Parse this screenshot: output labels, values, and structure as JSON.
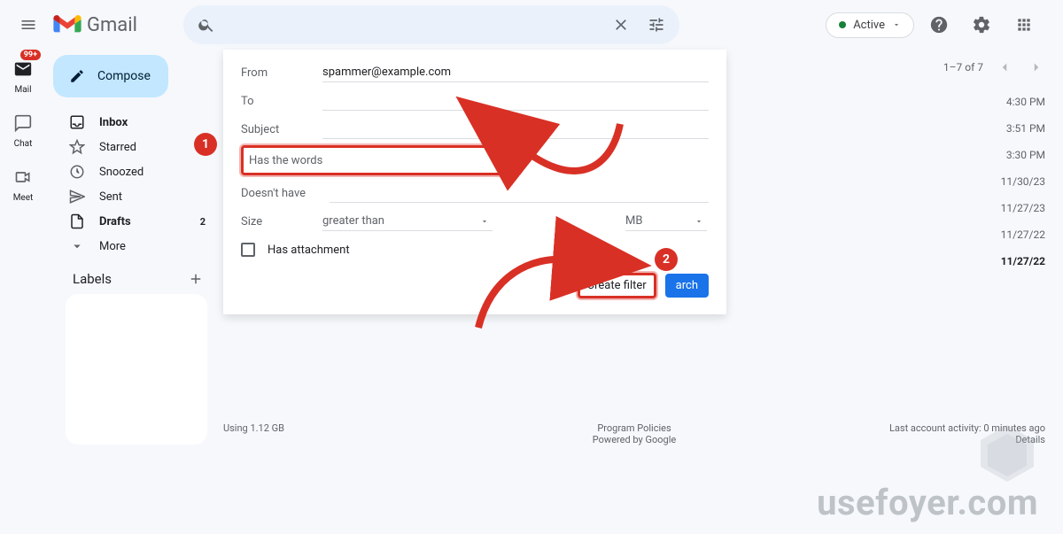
{
  "header": {
    "app_name": "Gmail",
    "active_label": "Active"
  },
  "rail": {
    "mail": "Mail",
    "chat": "Chat",
    "meet": "Meet",
    "badge": "99+"
  },
  "compose_label": "Compose",
  "folders": [
    {
      "label": "Inbox",
      "bold": true,
      "icon": "inbox"
    },
    {
      "label": "Starred",
      "icon": "star"
    },
    {
      "label": "Snoozed",
      "icon": "clock"
    },
    {
      "label": "Sent",
      "icon": "send"
    },
    {
      "label": "Drafts",
      "bold": true,
      "count": "2",
      "icon": "draft"
    },
    {
      "label": "More",
      "icon": "chevron"
    }
  ],
  "labels_header": "Labels",
  "filter": {
    "from_label": "From",
    "from_value": "spammer@example.com",
    "to_label": "To",
    "subject_label": "Subject",
    "haswords_label": "Has the words",
    "doesnthave_label": "Doesn't have",
    "size_label": "Size",
    "size_op": "greater than",
    "size_unit": "MB",
    "has_attachment_label": "Has attachment",
    "create_filter": "Create filter",
    "search_btn": "arch"
  },
  "page_info": "1–7 of 7",
  "mail_times": [
    "4:30 PM",
    "3:51 PM",
    "3:30 PM",
    "11/30/23",
    "11/27/23",
    "11/27/22",
    "11/27/22"
  ],
  "footer": {
    "usage": "Using 1.12 GB",
    "policies": "Program Policies",
    "powered": "Powered by Google",
    "activity": "Last account activity: 0 minutes ago",
    "details": "Details"
  },
  "watermark": "usefoyer.com",
  "annot": {
    "n1": "1",
    "n2": "2"
  }
}
